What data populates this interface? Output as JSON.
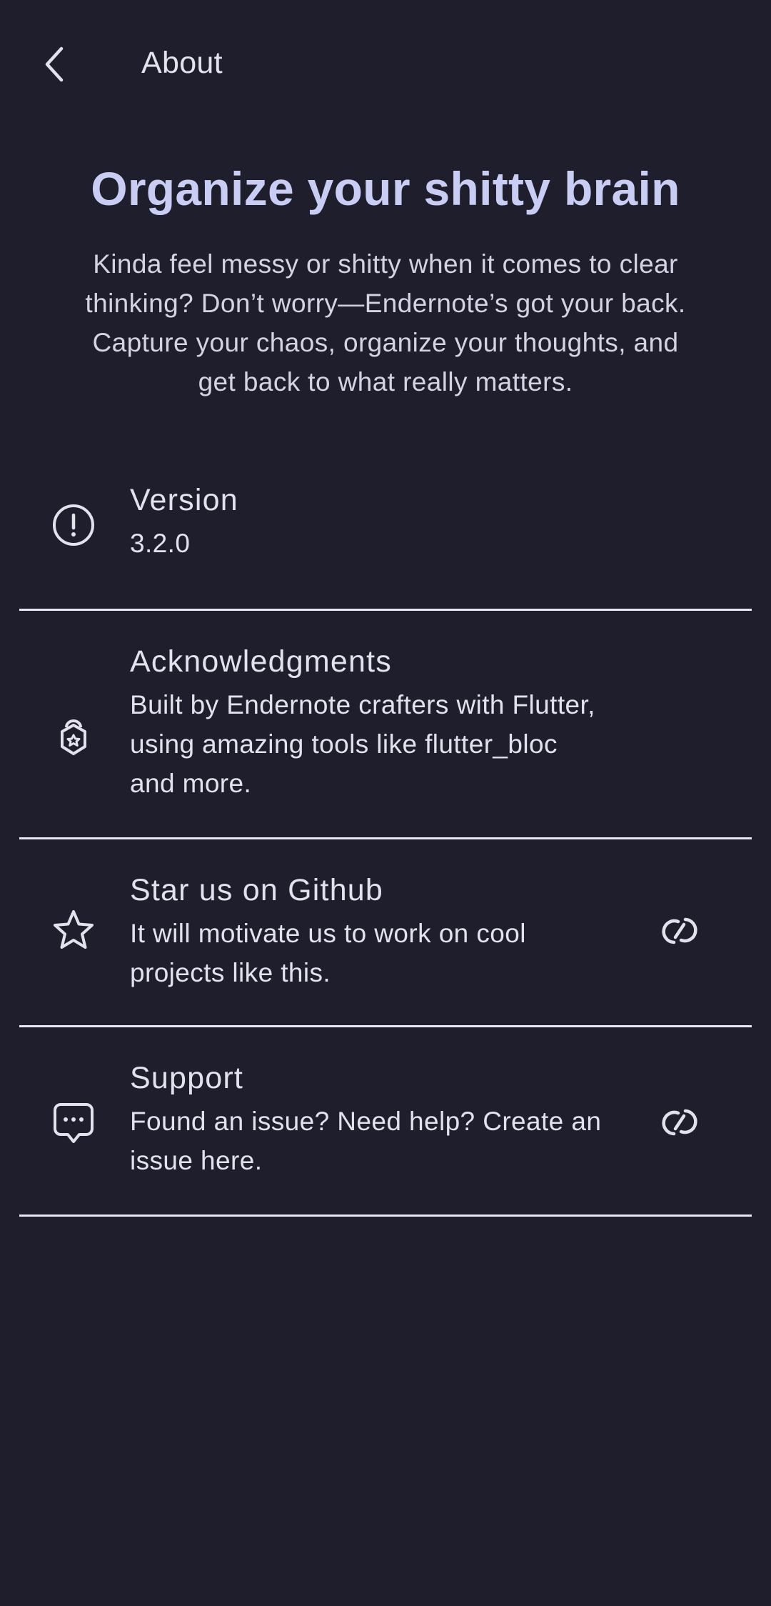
{
  "app_bar": {
    "title": "About",
    "back_icon": "chevron-left-icon"
  },
  "hero": {
    "title": "Organize your shitty brain",
    "description_lines": [
      "Kinda feel messy or shitty when it comes to clear",
      "thinking? Don’t worry—Endernote’s got your back.",
      "Capture your chaos, organize your thoughts, and",
      "get back to what really matters."
    ]
  },
  "items": [
    {
      "icon": "info-circle-icon",
      "title": "Version",
      "subtitle_lines": [
        "3.2.0"
      ]
    },
    {
      "icon": "badge-icon",
      "title": "Acknowledgments",
      "subtitle_lines": [
        "Built by Endernote crafters with Flutter,",
        "using amazing tools like flutter_bloc",
        "and more."
      ]
    },
    {
      "icon": "star-icon",
      "title": "Star us on Github",
      "subtitle_lines": [
        "It will motivate us to work on cool",
        "projects like this."
      ],
      "trailing_icon": "link-icon"
    },
    {
      "icon": "chat-bubble-icon",
      "title": "Support",
      "subtitle_lines": [
        "Found an issue? Need help? Create an",
        "issue here."
      ],
      "trailing_icon": "link-icon"
    }
  ],
  "colors": {
    "background": "#1e1e2d",
    "accent_title": "#c9cdf3",
    "text": "#e3e1ec",
    "divider": "#e9e8f2"
  }
}
